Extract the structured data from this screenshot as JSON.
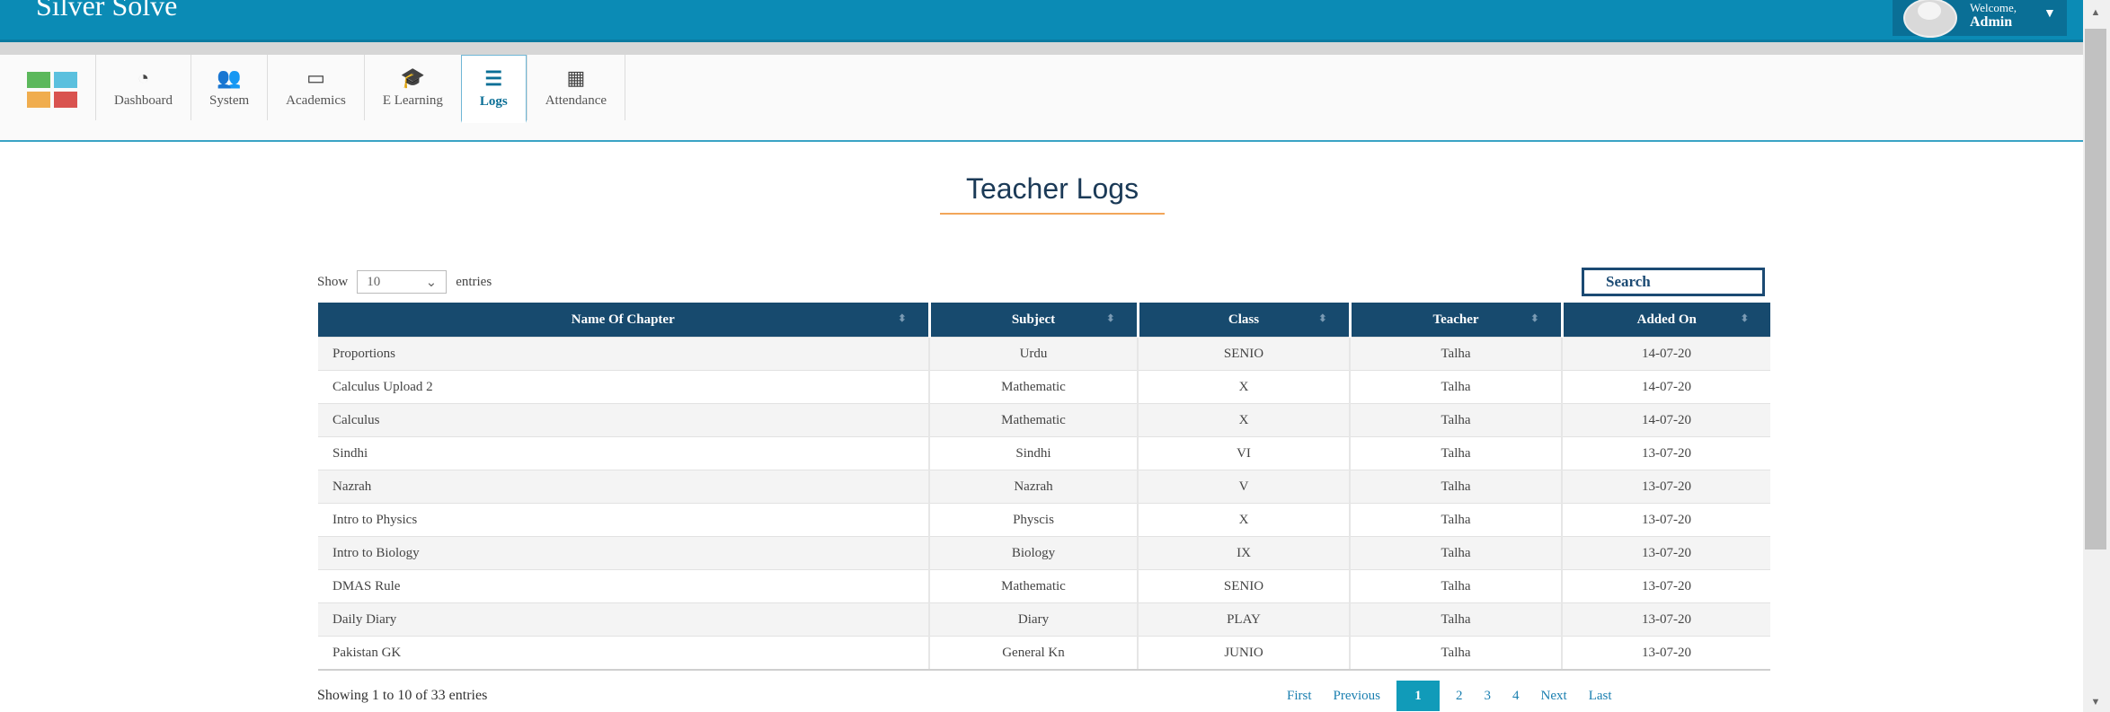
{
  "header": {
    "brand": "Silver Solve",
    "user_welcome": "Welcome,",
    "user_name": "Admin",
    "colors": {
      "bar": "#0b8bb5",
      "user_box": "#0a6f96"
    }
  },
  "apps_logo_colors": [
    "#5cb85c",
    "#5bc0de",
    "#f0ad4e",
    "#d9534f"
  ],
  "nav": {
    "items": [
      {
        "label": "Dashboard",
        "icon": "dashboard-icon"
      },
      {
        "label": "System",
        "icon": "users-icon"
      },
      {
        "label": "Academics",
        "icon": "id-card-icon"
      },
      {
        "label": "E Learning",
        "icon": "graduation-cap-icon"
      },
      {
        "label": "Logs",
        "icon": "logs-icon",
        "active": true
      },
      {
        "label": "Attendance",
        "icon": "calendar-icon"
      }
    ]
  },
  "page": {
    "title": "Teacher Logs"
  },
  "controls": {
    "show_label": "Show",
    "entries_label": "entries",
    "length_value": "10",
    "search_placeholder": "Search"
  },
  "table": {
    "columns": [
      "Name Of Chapter",
      "Subject",
      "Class",
      "Teacher",
      "Added On"
    ],
    "rows": [
      [
        "Proportions",
        "Urdu",
        "SENIO",
        "Talha",
        "14-07-20"
      ],
      [
        "Calculus Upload 2",
        "Mathematic",
        "X",
        "Talha",
        "14-07-20"
      ],
      [
        "Calculus",
        "Mathematic",
        "X",
        "Talha",
        "14-07-20"
      ],
      [
        "Sindhi",
        "Sindhi",
        "VI",
        "Talha",
        "13-07-20"
      ],
      [
        "Nazrah",
        "Nazrah",
        "V",
        "Talha",
        "13-07-20"
      ],
      [
        "Intro to Physics",
        "Physcis",
        "X",
        "Talha",
        "13-07-20"
      ],
      [
        "Intro to Biology",
        "Biology",
        "IX",
        "Talha",
        "13-07-20"
      ],
      [
        "DMAS Rule",
        "Mathematic",
        "SENIO",
        "Talha",
        "13-07-20"
      ],
      [
        "Daily Diary",
        "Diary",
        "PLAY",
        "Talha",
        "13-07-20"
      ],
      [
        "Pakistan GK",
        "General Kn",
        "JUNIO",
        "Talha",
        "13-07-20"
      ]
    ]
  },
  "footer": {
    "info": "Showing 1 to 10 of 33 entries",
    "pagination": [
      "First",
      "Previous",
      "1",
      "2",
      "3",
      "4",
      "Next",
      "Last"
    ],
    "active_page": "1"
  }
}
